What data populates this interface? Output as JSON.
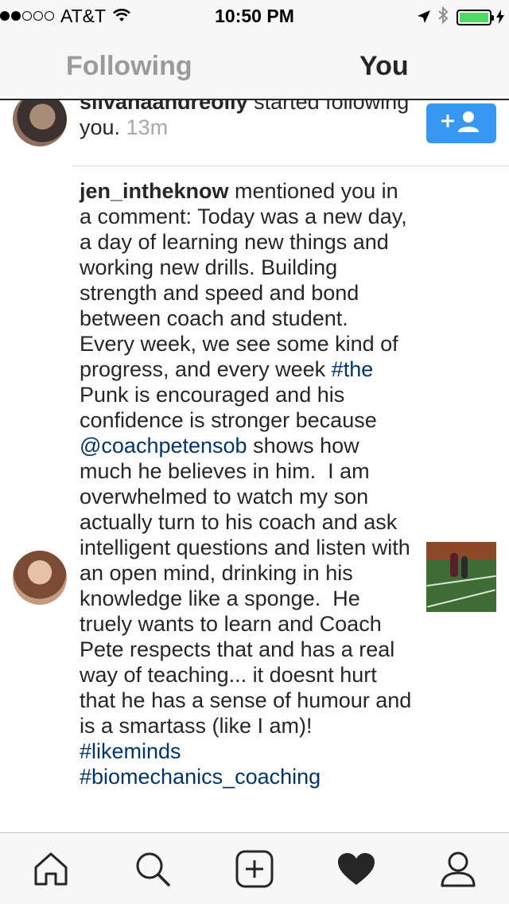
{
  "status_bar": {
    "carrier": "AT&T",
    "time": "10:50 PM",
    "signal_bars_filled": 2,
    "signal_bars_total": 5
  },
  "tabs": {
    "following": "Following",
    "you": "You",
    "active": "You"
  },
  "feed": {
    "item1": {
      "username_partial": "silvanaandreolly",
      "action": " started following you.",
      "time": "13m"
    },
    "item2": {
      "username": "jen_intheknow",
      "text_1": " mentioned you in a comment: Today was a new day, a day of learning new things and working new drills. Building strength and speed and bond between coach and student.  Every week, we see some kind of progress, and every week ",
      "hashtag_1": "#the",
      "text_2": " Punk is encouraged and his confidence is stronger because ",
      "mention_1": "@coachpetensob",
      "text_3": " shows how much he believes in him.  I am overwhelmed to watch my son actually turn to his coach and ask intelligent questions and listen with an open mind, drinking in his knowledge like a sponge.  He truely wants to learn and Coach Pete respects that and has a real way of teaching... it doesnt hurt that he has a sense of humour and is a smartass (like I am)! ",
      "hashtag_2": "#likeminds",
      "hashtag_3": "#biomechanics_coaching"
    }
  },
  "colors": {
    "follow_button": "#3897f0",
    "link": "#003569",
    "battery": "#4cd964"
  },
  "icons": {
    "bottom_nav": [
      "home-icon",
      "search-icon",
      "add-post-icon",
      "heart-icon",
      "profile-icon"
    ]
  }
}
